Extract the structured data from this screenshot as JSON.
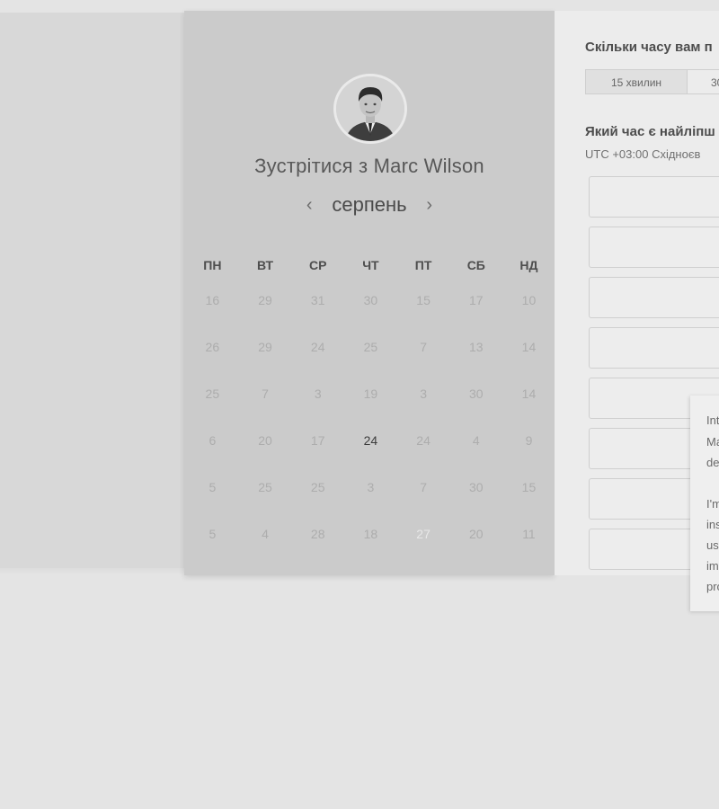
{
  "header": {
    "meet_title": "Зустрітися з Marc Wilson",
    "avatar_alt": "Marc Wilson"
  },
  "calendar": {
    "month": "серпень",
    "prev_label": "‹",
    "next_label": "›",
    "weekdays": [
      "ПН",
      "ВТ",
      "СР",
      "ЧТ",
      "ПТ",
      "СБ",
      "НД"
    ],
    "weeks": [
      [
        "16",
        "29",
        "31",
        "30",
        "15",
        "17",
        "10"
      ],
      [
        "26",
        "29",
        "24",
        "25",
        "7",
        "13",
        "14"
      ],
      [
        "25",
        "7",
        "3",
        "19",
        "3",
        "30",
        "14"
      ],
      [
        "6",
        "20",
        "17",
        "24",
        "24",
        "4",
        "9"
      ],
      [
        "5",
        "25",
        "25",
        "3",
        "7",
        "30",
        "15"
      ],
      [
        "5",
        "4",
        "28",
        "18",
        "27",
        "20",
        "11"
      ]
    ],
    "available": [
      [
        3,
        3
      ],
      [
        5,
        4
      ]
    ],
    "selected": [
      5,
      4
    ]
  },
  "booking": {
    "duration_question": "Скільки часу вам п",
    "durations": [
      "15 хвилин",
      "30"
    ],
    "time_question": "Який час є найліпш",
    "timezone": "UTC +03:00 Східноєв",
    "slots": [
      "",
      "",
      "",
      "",
      "",
      "",
      ""
    ]
  },
  "tooltip": {
    "lines": [
      "Int",
      "Ma",
      "de",
      "",
      "I'm",
      "ins",
      "us",
      "im",
      "pro"
    ]
  },
  "colors": {
    "selected_day_bg": "#5e5e5e",
    "panel_bg": "#cbcbcb"
  }
}
